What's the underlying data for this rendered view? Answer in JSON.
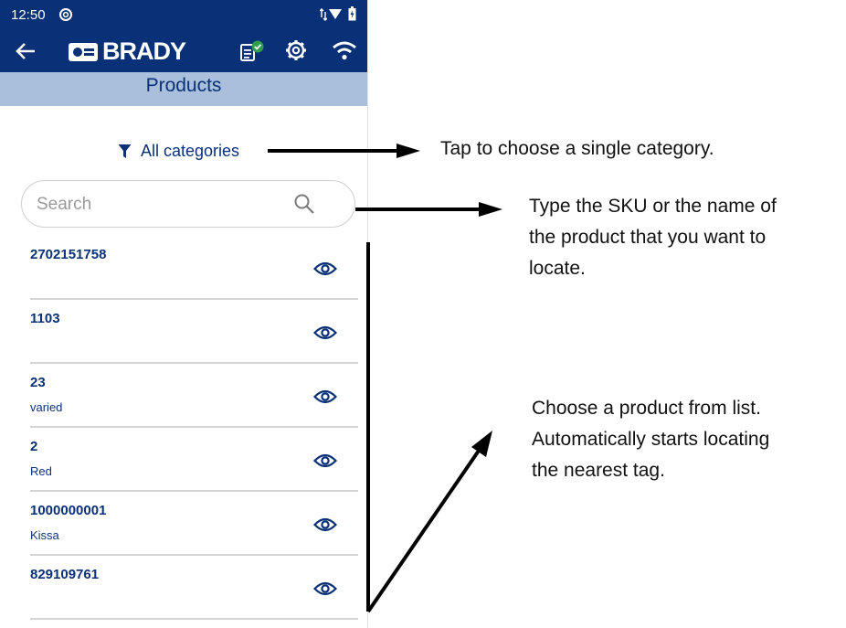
{
  "status_bar": {
    "time": "12:50"
  },
  "app_bar": {
    "logo_text": "BRADY"
  },
  "title_bar": {
    "title": "Products"
  },
  "filter": {
    "label": "All categories"
  },
  "search": {
    "placeholder": "Search"
  },
  "products": [
    {
      "sku": "2702151758",
      "description": ""
    },
    {
      "sku": "1103",
      "description": ""
    },
    {
      "sku": "23",
      "description": "varied"
    },
    {
      "sku": "2",
      "description": "Red"
    },
    {
      "sku": "1000000001",
      "description": "Kissa"
    },
    {
      "sku": "829109761",
      "description": ""
    }
  ],
  "annotations": {
    "filter_note": "Tap to choose a single category.",
    "search_note_line1": "Type the SKU or the name of",
    "search_note_line2": "the product that you want to",
    "search_note_line3": "locate.",
    "list_note_line1": "Choose a product from list.",
    "list_note_line2": "Automatically starts locating",
    "list_note_line3": "the nearest tag."
  },
  "colors": {
    "brand_navy": "#0a3178",
    "title_bar_bg": "#a9bfdb",
    "sync_badge_green": "#2e9e4a"
  }
}
